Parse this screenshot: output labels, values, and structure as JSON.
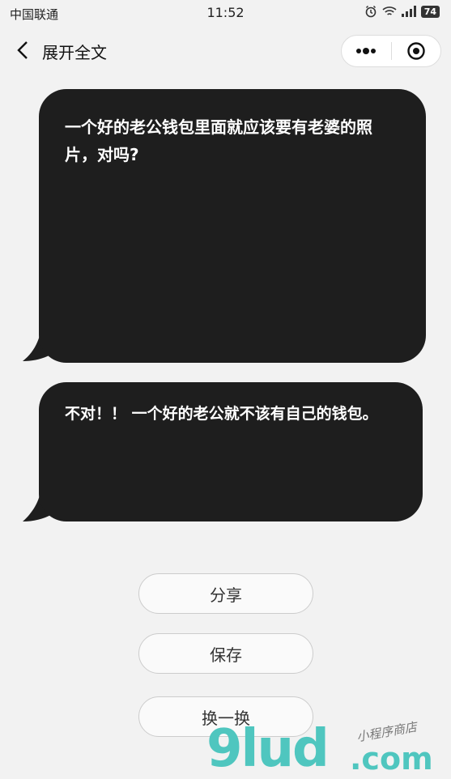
{
  "status_bar": {
    "carrier": "中国联通",
    "time": "11:52",
    "battery": "74"
  },
  "navbar": {
    "back_icon": "chevron-left-icon",
    "title": "展开全文"
  },
  "bubbles": {
    "question": "一个好的老公钱包里面就应该要有老婆的照片，对吗?",
    "answer": "不对！！ 一个好的老公就不该有自己的钱包。"
  },
  "buttons": {
    "share": "分享",
    "save": "保存",
    "next": "换一换"
  },
  "watermark": {
    "logo": "9lud",
    "domain": ".com",
    "tagline": "小程序商店"
  },
  "colors": {
    "bubble": "#1e1e1e",
    "background": "#f2f2f2",
    "watermark": "#4fc6bf"
  }
}
